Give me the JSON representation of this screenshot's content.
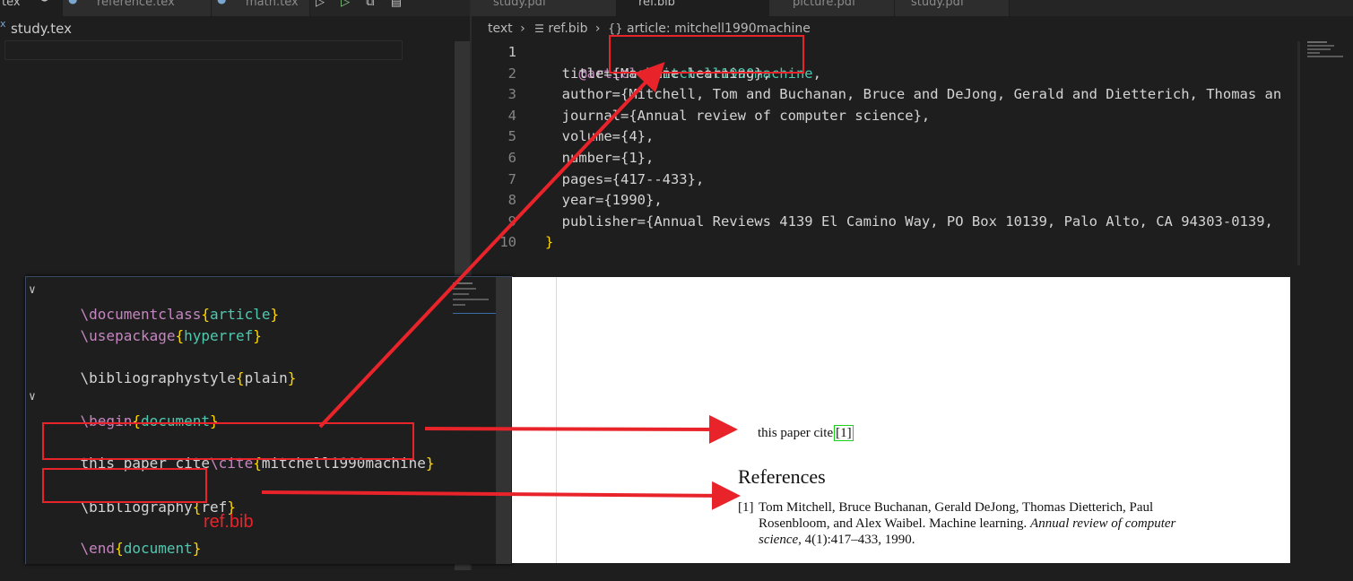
{
  "left_tabs": {
    "first_tab_label": "tex",
    "tabs": [
      "reference.tex",
      "math.tex"
    ]
  },
  "right_tabs": {
    "tabs": [
      "study.pdf",
      "ref.bib",
      "picture.pdf",
      "study.pdf"
    ],
    "active": "ref.bib"
  },
  "left_editor": {
    "file_label": "study.tex"
  },
  "breadcrumb": {
    "folder": "text",
    "file": "ref.bib",
    "symbol": "article: mitchell1990machine"
  },
  "bib": {
    "line_numbers": [
      "1",
      "2",
      "3",
      "4",
      "5",
      "6",
      "7",
      "8",
      "9",
      "10"
    ],
    "at_article": "@article",
    "open_brace": "{",
    "key": "mitchell1990machine",
    "key_comma": ",",
    "fields": [
      "  title={Machine learning},",
      "  author={Mitchell, Tom and Buchanan, Bruce and DeJong, Gerald and Dietterich, Thomas an",
      "  journal={Annual review of computer science},",
      "  volume={4},",
      "  number={1},",
      "  pages={417--433},",
      "  year={1990},",
      "  publisher={Annual Reviews 4139 El Camino Way, PO Box 10139, Palo Alto, CA 94303-0139,"
    ],
    "close_brace": "}"
  },
  "tex": {
    "documentclass_cmd": "\\documentclass",
    "documentclass_arg": "article",
    "usepackage_cmd": "\\usepackage",
    "usepackage_arg": "hyperref",
    "bibstyle_cmd": "\\bibliographystyle",
    "bibstyle_arg": "plain",
    "begin_cmd": "\\begin",
    "begin_arg": "document",
    "cite_text": "this paper cite",
    "cite_cmd": "\\cite",
    "cite_arg": "mitchell1990machine",
    "bibliography_cmd": "\\bibliography",
    "bibliography_arg": "ref",
    "end_cmd": "\\end",
    "end_arg": "document",
    "lbrace": "{",
    "rbrace": "}",
    "annotation": "ref.bib"
  },
  "pdf": {
    "cite_sentence": "this paper cite",
    "cite_number": "1",
    "references_heading": "References",
    "ref_label": "[1]",
    "ref_line1": "Tom Mitchell, Bruce Buchanan, Gerald DeJong, Thomas Dietterich, Paul",
    "ref_line2_plain": "Rosenbloom, and Alex Waibel. Machine learning. ",
    "ref_line2_italic": "Annual review of computer",
    "ref_line3_italic": "science",
    "ref_line3_plain": ", 4(1):417–433, 1990."
  },
  "colors": {
    "annotation_red": "#e8232a",
    "editor_bg": "#1e1e1e",
    "keyword": "#c586c0",
    "brace": "#ffd700",
    "argument": "#4ec9b0"
  }
}
